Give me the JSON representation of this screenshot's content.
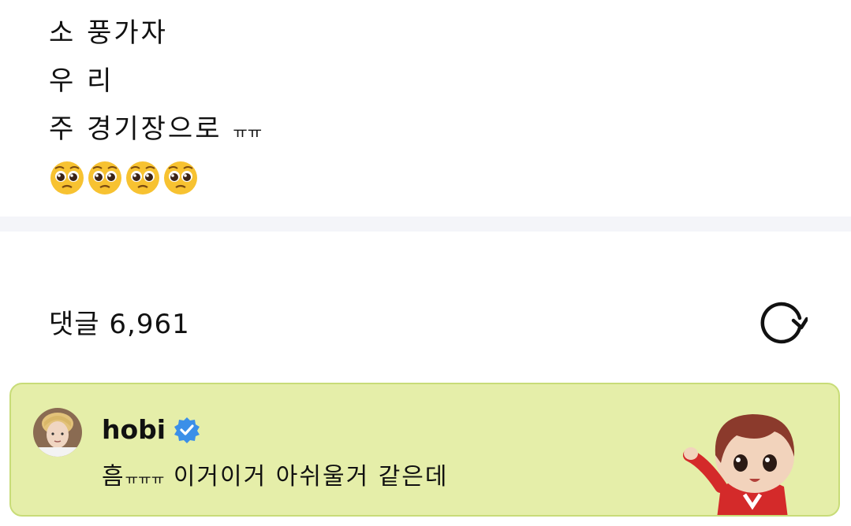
{
  "post": {
    "line1": "소 풍가자",
    "line2": "우 리",
    "line3_main": "주 경기장으로",
    "line3_tail": "ㅠㅠ",
    "emojis": [
      "pleading-face",
      "pleading-face",
      "pleading-face",
      "pleading-face"
    ]
  },
  "comments": {
    "label": "댓글",
    "count": "6,961",
    "refresh_icon": "refresh-icon"
  },
  "pinned_comment": {
    "author": "hobi",
    "verified_icon": "verified-badge-icon",
    "text_main": "흠",
    "text_tail": "ㅠㅠㅠ",
    "text_rest": " 이거이거 아쉬울거 같은데"
  },
  "colors": {
    "pinned_bg": "#e5eea9",
    "pinned_border": "#c8dc78",
    "verified": "#3b8fe8",
    "divider": "#f4f5f9"
  }
}
